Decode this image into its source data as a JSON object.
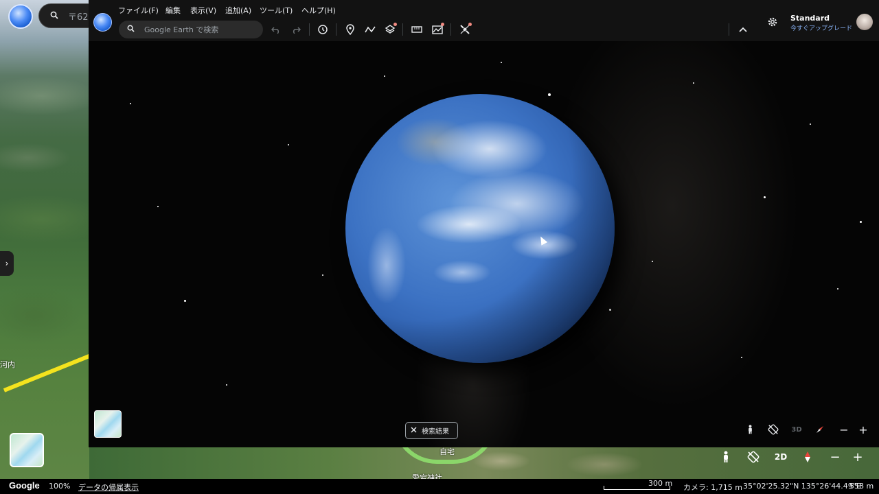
{
  "outer": {
    "search_text": "〒62",
    "place_label": "河内",
    "place_home": "自宅",
    "place_shrine": "愛宕神社"
  },
  "status_bar": {
    "brand": "Google",
    "zoom": "100%",
    "attribution": "データの帰属表示",
    "scale": "300 m",
    "camera": "カメラ: 1,715 m",
    "coords": "35°02'25.32\"N 135°26'44.49\"E",
    "elevation": "558 m"
  },
  "outer_controls": {
    "mode_2d": "2D"
  },
  "menu": {
    "items": [
      "ファイル(F)",
      "編集",
      "表示(V)",
      "追加(A)",
      "ツール(T)",
      "ヘルプ(H)"
    ]
  },
  "toolbar": {
    "search_placeholder": "Google Earth で検索"
  },
  "account": {
    "plan": "Standard",
    "upgrade": "今すぐアップグレード"
  },
  "inner_controls": {
    "mode_3d": "3D"
  },
  "search_results_chip": {
    "label": "検索結果"
  }
}
